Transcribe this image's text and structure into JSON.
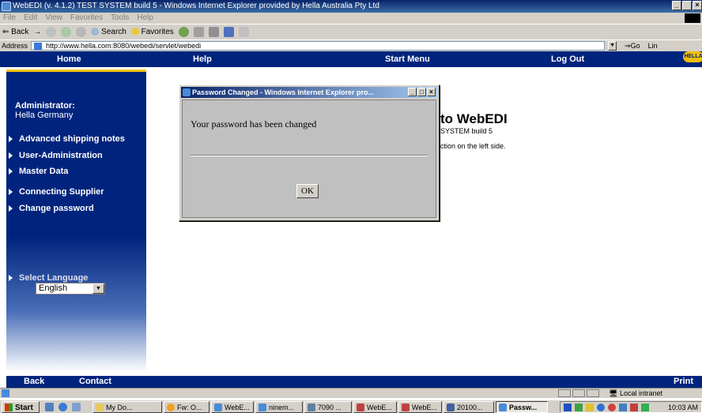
{
  "window": {
    "title": "WebEDI (v. 4.1.2) TEST SYSTEM build 5 - Windows Internet Explorer provided by Hella Australia Pty Ltd",
    "controls": [
      "_",
      " ",
      "×"
    ]
  },
  "menubar": [
    "File",
    "Edit",
    "View",
    "Favorites",
    "Tools",
    "Help"
  ],
  "toolbar": {
    "back": "⇐ Back",
    "search": "Search",
    "favorites": "Favorites"
  },
  "addressbar": {
    "label": "Address",
    "url": "http://www.hella.com:8080/webedi/servlet/webedi",
    "go": "Go",
    "links": "Lin"
  },
  "topnav": {
    "home": "Home",
    "help": "Help",
    "start_menu": "Start Menu",
    "log_out": "Log Out",
    "logo": "HELLA"
  },
  "sidebar": {
    "role": "Administrator:",
    "company": "Hella Germany",
    "items": [
      "Advanced shipping notes",
      "User-Administration",
      "Master Data",
      "Connecting Supplier",
      "Change password"
    ],
    "language_label": "Select Language",
    "language_value": "English"
  },
  "main": {
    "welcome": "to WebEDI",
    "build": "SYSTEM build 5",
    "hint": "ction on the left side."
  },
  "dialog": {
    "title": "Password Changed - Windows Internet Explorer pro...",
    "message": "Your password has been changed",
    "ok": "OK"
  },
  "bottomnav": {
    "back": "Back",
    "contact": "Contact",
    "print": "Print"
  },
  "statusbar": {
    "zone": "Local intranet"
  },
  "taskbar": {
    "start": "Start",
    "tasks": [
      "My Do...",
      "Fw: O...",
      "WebE...",
      "ninem...",
      "7090 ...",
      "WebE...",
      "WebE...",
      "20100...",
      "Passw..."
    ],
    "clock": "10:03 AM"
  },
  "colors": {
    "nav_blue": "#00247d",
    "accent_yellow": "#f5c400",
    "dialog_gray": "#c0c0c0"
  }
}
